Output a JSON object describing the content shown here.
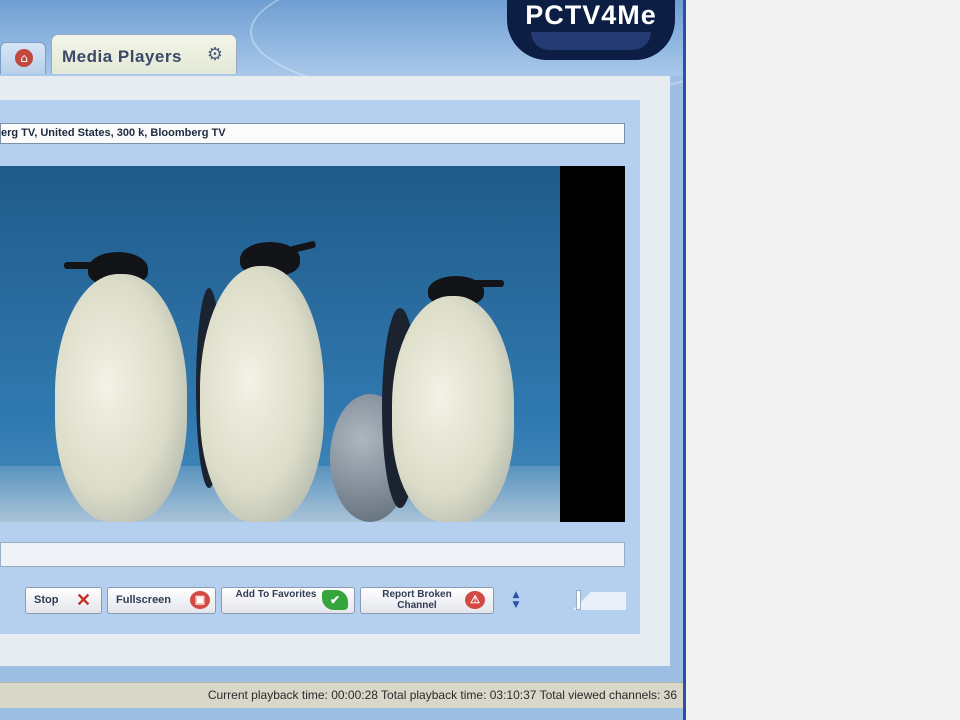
{
  "header": {
    "logo_text": "PCTV4Me",
    "home_tab_icon": "home-icon",
    "tab_label": "Media Players",
    "tab_icon": "media-players-icon"
  },
  "player": {
    "channel_text": "erg TV, United States, 300 k, Bloomberg TV"
  },
  "controls": {
    "stop_label": "Stop",
    "stop_icon": "close-x-icon",
    "fullscreen_label": "Fullscreen",
    "fullscreen_icon": "fullscreen-icon",
    "favorites_label": "Add To Favorites",
    "favorites_icon": "green-check-icon",
    "report_label": "Report Broken Channel",
    "report_icon": "report-icon",
    "volume_icon": "volume-arrows-icon",
    "volume_level": 0.45
  },
  "status": {
    "text": "Current playback time: 00:00:28  Total playback time: 03:10:37  Total viewed channels: 36"
  },
  "colors": {
    "frame_blue": "#9cbfe3",
    "border_blue": "#2e4fa8",
    "logo_navy": "#0d1e44"
  }
}
